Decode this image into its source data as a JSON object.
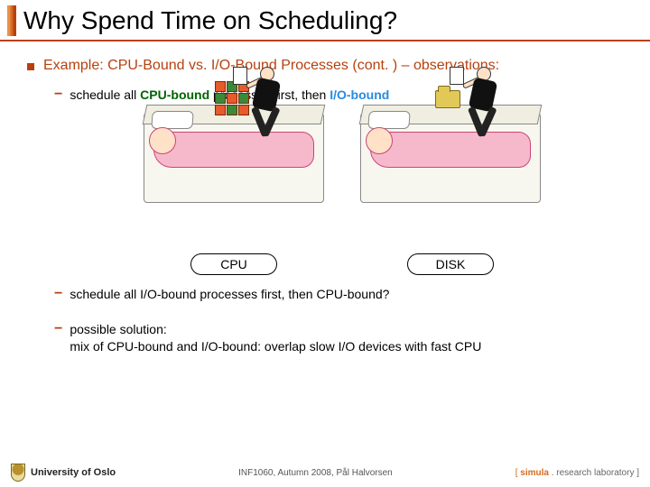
{
  "title": "Why Spend Time on Scheduling?",
  "main_bullet": "Example: CPU-Bound vs. I/O-Bound Processes (cont. ) – observations:",
  "sub1": {
    "pre": "schedule all ",
    "cpu": "CPU-bound",
    "mid": " processes first, then ",
    "io": "I/O-bound"
  },
  "illus": {
    "cpu_label": "CPU",
    "disk_label": "DISK"
  },
  "sub2": "schedule all I/O-bound processes first, then CPU-bound?",
  "sub3_line1": "possible solution:",
  "sub3_line2": "mix of CPU-bound and I/O-bound: overlap slow I/O devices with fast CPU",
  "footer": {
    "university": "University of Oslo",
    "center": "INF1060, Autumn 2008, Pål Halvorsen",
    "simula_open": "[ ",
    "simula_name": "simula",
    "simula_rest": " . research laboratory ]"
  }
}
